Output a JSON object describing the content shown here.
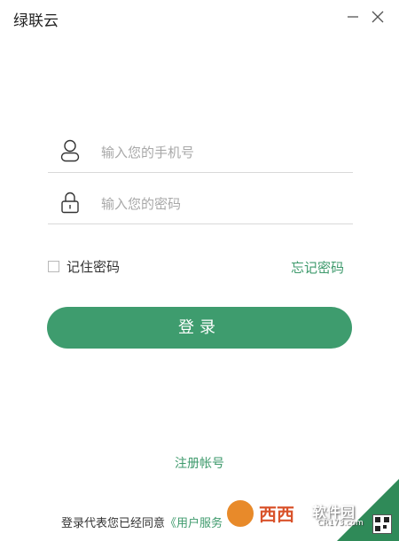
{
  "window": {
    "title": "绿联云",
    "minimize_icon": "minimize-icon",
    "close_icon": "close-icon"
  },
  "login": {
    "phone": {
      "placeholder": "输入您的手机号",
      "value": "",
      "icon": "user-icon"
    },
    "password": {
      "placeholder": "输入您的密码",
      "value": "",
      "icon": "lock-icon"
    },
    "remember_label": "记住密码",
    "remember_checked": false,
    "forgot_label": "忘记密码",
    "submit_label": "登录"
  },
  "footer": {
    "register_label": "注册帐号",
    "agreement_prefix": "登录代表您已经同意",
    "agreement_link": "《用户服务"
  },
  "watermark": {
    "brand": "西西",
    "name": "软件园",
    "site": "CR173.com"
  },
  "colors": {
    "accent": "#3e9c6e",
    "link": "#3e9a6c",
    "text": "#333333",
    "placeholder": "#a8a8a8",
    "divider": "#d9d9d9"
  }
}
